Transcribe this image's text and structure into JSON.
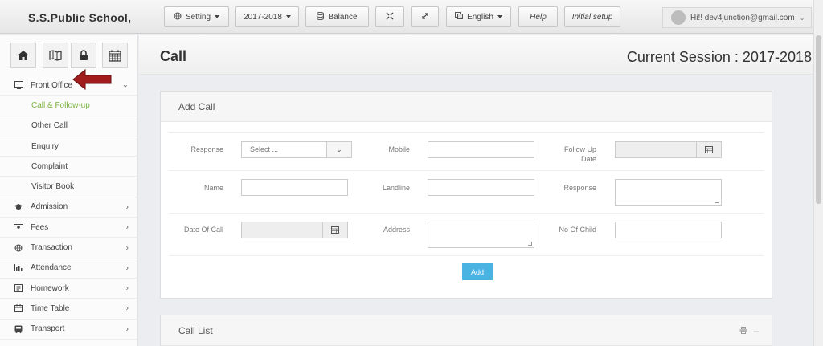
{
  "app": {
    "brand": "S.S.Public School,"
  },
  "topbar": {
    "setting": "Setting",
    "year": "2017-2018",
    "balance": "Balance",
    "language": "English",
    "help": "Help",
    "initial_setup": "Initial setup",
    "user": "Hi!! dev4junction@gmail.com"
  },
  "sidebar": {
    "quick_icons": [
      "home-icon",
      "map-icon",
      "lock-icon",
      "calendar-icon"
    ],
    "items": [
      {
        "label": "Front Office",
        "icon": "monitor-icon",
        "chevron": "down"
      },
      {
        "label": "Call & Follow-up",
        "sub": true,
        "active": true
      },
      {
        "label": "Other Call",
        "sub": true
      },
      {
        "label": "Enquiry",
        "sub": true
      },
      {
        "label": "Complaint",
        "sub": true
      },
      {
        "label": "Visitor Book",
        "sub": true
      },
      {
        "label": "Admission",
        "icon": "graduation-cap-icon"
      },
      {
        "label": "Fees",
        "icon": "money-icon"
      },
      {
        "label": "Transaction",
        "icon": "globe-icon"
      },
      {
        "label": "Attendance",
        "icon": "bar-chart-icon"
      },
      {
        "label": "Homework",
        "icon": "book-icon"
      },
      {
        "label": "Time Table",
        "icon": "calendar-icon"
      },
      {
        "label": "Transport",
        "icon": "bus-icon"
      }
    ]
  },
  "page": {
    "title": "Call",
    "session": "Current Session : 2017-2018"
  },
  "form": {
    "title": "Add Call",
    "response_label": "Response",
    "response_value": "Select ...",
    "mobile_label": "Mobile",
    "followup_label_1": "Follow Up",
    "followup_label_2": "Date",
    "name_label": "Name",
    "landline_label": "Landline",
    "response2_label": "Response",
    "date_of_call_label": "Date Of Call",
    "address_label": "Address",
    "no_of_child_label": "No Of Child",
    "add_button": "Add"
  },
  "call_list": {
    "title": "Call List"
  },
  "colors": {
    "accent": "#4ab3e2",
    "active": "#7cb342",
    "arrow": "#a11d1d"
  }
}
